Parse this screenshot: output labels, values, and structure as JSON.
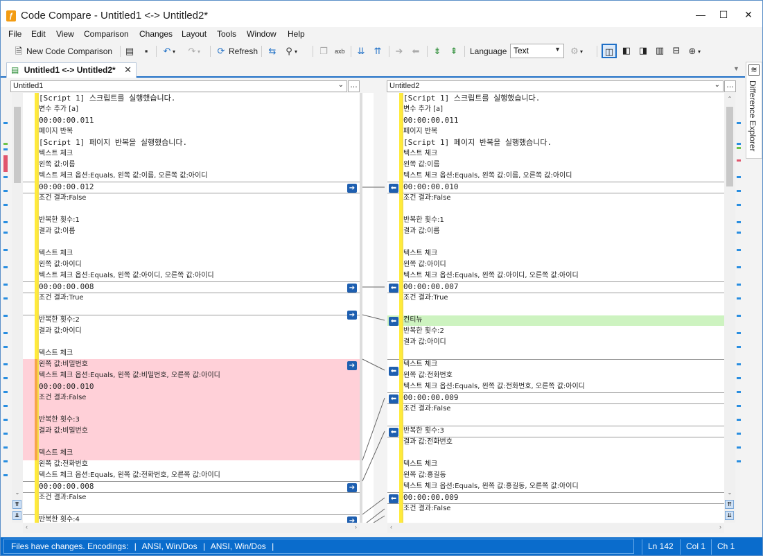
{
  "window": {
    "title": "Code Compare - Untitled1 <-> Untitled2*",
    "app_icon_glyph": "ƒ"
  },
  "menu": [
    "File",
    "Edit",
    "View",
    "Comparison",
    "Changes",
    "Layout",
    "Tools",
    "Window",
    "Help"
  ],
  "toolbar": {
    "new_comparison": "New Code Comparison",
    "refresh": "Refresh",
    "language_label": "Language",
    "language_value": "Text",
    "axb_label": "axb"
  },
  "tab": {
    "label": "Untitled1 <-> Untitled2*"
  },
  "side_panel": {
    "label": "Difference Explorer"
  },
  "left": {
    "path": "Untitled1",
    "lines": [
      "[Script 1] 스크립트를 실행했습니다.",
      "변수 추가 [a]",
      "00:00:00.011",
      "페이지 반복",
      "[Script 1] 페이지 반복을 실행했습니다.",
      "텍스트 체크",
      "왼쪽 값:이름",
      "텍스트 체크 옵션:Equals, 왼쪽 값:이름, 오른쪽 값:아이디",
      "00:00:00.012",
      "조건 결과:False",
      "",
      "반복한 횟수:1",
      "결과 값:이름",
      "",
      "텍스트 체크",
      "왼쪽 값:아이디",
      "텍스트 체크 옵션:Equals, 왼쪽 값:아이디, 오른쪽 값:아이디",
      "00:00:00.008",
      "조건 결과:True",
      "",
      "반복한 횟수:2",
      "결과 값:아이디",
      "",
      "텍스트 체크",
      "왼쪽 값:비밀번호",
      "텍스트 체크 옵션:Equals, 왼쪽 값:비밀번호, 오른쪽 값:아이디",
      "00:00:00.010",
      "조건 결과:False",
      "",
      "반복한 횟수:3",
      "결과 값:비밀번호",
      "",
      "텍스트 체크",
      "왼쪽 값:전화번호",
      "텍스트 체크 옵션:Equals, 왼쪽 값:전화번호, 오른쪽 값:아이디",
      "00:00:00.008",
      "조건 결과:False",
      "",
      "반복한 횟수:4"
    ]
  },
  "right": {
    "path": "Untitled2",
    "lines": [
      "[Script 1] 스크립트를 실행했습니다.",
      "변수 추가 [a]",
      "00:00:00.011",
      "페이지 반복",
      "[Script 1] 페이지 반복을 실행했습니다.",
      "텍스트 체크",
      "왼쪽 값:이름",
      "텍스트 체크 옵션:Equals, 왼쪽 값:이름, 오른쪽 값:아이디",
      "00:00:00.010",
      "조건 결과:False",
      "",
      "반복한 횟수:1",
      "결과 값:이름",
      "",
      "텍스트 체크",
      "왼쪽 값:아이디",
      "텍스트 체크 옵션:Equals, 왼쪽 값:아이디, 오른쪽 값:아이디",
      "00:00:00.007",
      "조건 결과:True",
      "",
      "컨티뉴",
      "반복한 횟수:2",
      "결과 값:아이디",
      "",
      "텍스트 체크",
      "왼쪽 값:전화번호",
      "텍스트 체크 옵션:Equals, 왼쪽 값:전화번호, 오른쪽 값:아이디",
      "00:00:00.009",
      "조건 결과:False",
      "",
      "반복한 횟수:3",
      "결과 값:전화번호",
      "",
      "텍스트 체크",
      "왼쪽 값:홍길동",
      "텍스트 체크 옵션:Equals, 왼쪽 값:홍길동, 오른쪽 값:아이디",
      "00:00:00.009",
      "조건 결과:False"
    ]
  },
  "status": {
    "message": "Files have changes. Encodings:",
    "enc1": "ANSI, Win/Dos",
    "enc2": "ANSI, Win/Dos",
    "ln": "Ln 142",
    "col": "Col 1",
    "ch": "Ch 1"
  },
  "colors": {
    "accent": "#0a6ccc",
    "deleted": "#ffd0d8",
    "added": "#cdf3c0",
    "gutter": "#ffeb3b"
  }
}
